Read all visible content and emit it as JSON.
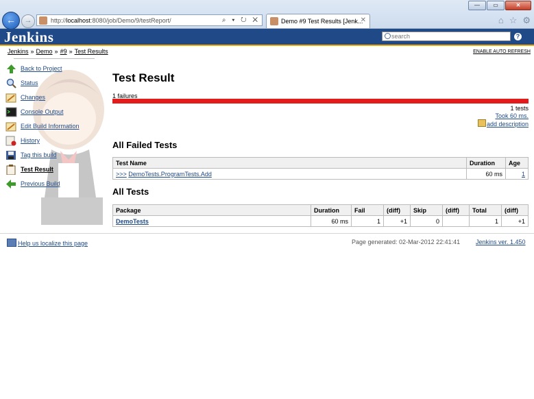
{
  "browser": {
    "url_prefix": "http://",
    "url_host": "localhost",
    "url_rest": ":8080/job/Demo/9/testReport/",
    "address_tools": "⌕ ▾ ↻ ✕",
    "tab_title": "Demo #9 Test Results [Jenk...",
    "tab_close": "✕",
    "back": "←",
    "forward": "→",
    "home_icon": "⌂",
    "star_icon": "☆",
    "gear_icon": "⚙",
    "minimize": "—",
    "maximize": "▭",
    "close": "✕"
  },
  "header": {
    "logo": "Jenkins",
    "search_placeholder": "search",
    "help": "?"
  },
  "breadcrumb": {
    "items": [
      "Jenkins",
      "Demo",
      "#9",
      "Test Results"
    ],
    "sep": "»",
    "auto_refresh": "ENABLE AUTO REFRESH"
  },
  "sidebar": {
    "items": [
      {
        "label": "Back to Project",
        "icon": "up-arrow-icon",
        "color": "#3e9a2a"
      },
      {
        "label": "Status",
        "icon": "magnifier-icon",
        "color": "#6d8fc0"
      },
      {
        "label": "Changes",
        "icon": "notepad-icon",
        "color": "#d8b45a"
      },
      {
        "label": "Console Output",
        "icon": "terminal-icon",
        "color": "#2c2c2c"
      },
      {
        "label": "Edit Build Information",
        "icon": "notepad-icon",
        "color": "#d8b45a"
      },
      {
        "label": "History",
        "icon": "notepad-icon",
        "color": "#9a5a5a"
      },
      {
        "label": "Tag this build",
        "icon": "save-icon",
        "color": "#3f5f9a"
      },
      {
        "label": "Test Result",
        "icon": "clipboard-icon",
        "color": "#b08a4a"
      },
      {
        "label": "Previous Build",
        "icon": "left-arrow-icon",
        "color": "#3e9a2a"
      }
    ]
  },
  "main": {
    "title": "Test Result",
    "failures_label": "1 failures",
    "fail_color": "#e21b1b",
    "test_count": "1 tests",
    "took": "Took 60 ms.",
    "add_description": "add description",
    "failed_section": "All Failed Tests",
    "failed_headers": [
      "Test Name",
      "Duration",
      "Age"
    ],
    "failed_rows": [
      {
        "expander": ">>>",
        "name": "DemoTests.ProgramTests.Add",
        "duration": "60 ms",
        "age": "1"
      }
    ],
    "all_section": "All Tests",
    "all_headers": [
      "Package",
      "Duration",
      "Fail",
      "(diff)",
      "Skip",
      "(diff)",
      "Total",
      "(diff)"
    ],
    "all_rows": [
      {
        "package": "DemoTests",
        "duration": "60 ms",
        "fail": "1",
        "fail_diff": "+1",
        "skip": "0",
        "skip_diff": "",
        "total": "1",
        "total_diff": "+1"
      }
    ]
  },
  "footer": {
    "localize": "Help us localize this page",
    "generated": "Page generated: 02-Mar-2012 22:41:41",
    "version": "Jenkins ver. 1.450"
  }
}
